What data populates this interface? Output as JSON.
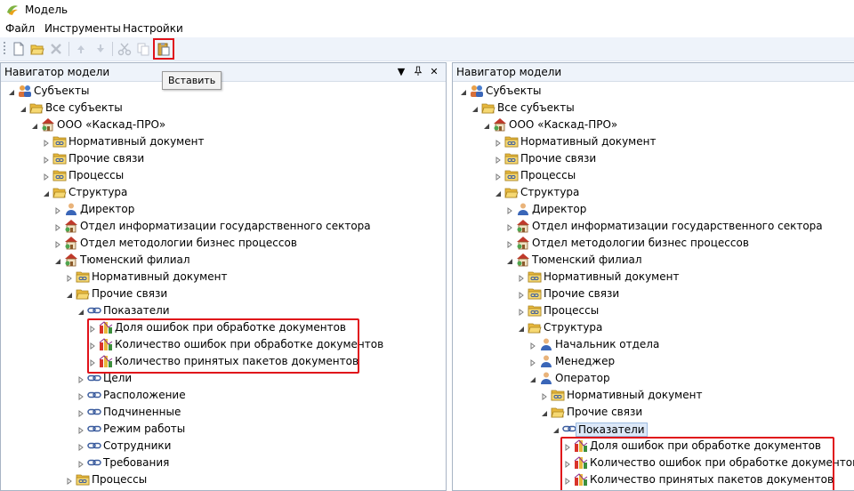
{
  "window": {
    "title": "Модель"
  },
  "menu": [
    "Файл",
    "Инструменты",
    "Настройки"
  ],
  "toolbar": {
    "tooltip": "Вставить"
  },
  "panels": [
    {
      "title": "Навигатор модели",
      "has_controls": true,
      "nodes": [
        {
          "d": 0,
          "exp": "open",
          "icon": "subjects-icon",
          "label": "Субъекты"
        },
        {
          "d": 1,
          "exp": "open",
          "icon": "folder-open-icon",
          "label": "Все субъекты"
        },
        {
          "d": 2,
          "exp": "open",
          "icon": "organization-icon",
          "label": "ООО «Каскад-ПРО»"
        },
        {
          "d": 3,
          "exp": "closed",
          "icon": "folder-link-icon",
          "label": "Нормативный документ"
        },
        {
          "d": 3,
          "exp": "closed",
          "icon": "folder-link-icon",
          "label": "Прочие связи"
        },
        {
          "d": 3,
          "exp": "closed",
          "icon": "folder-link-icon",
          "label": "Процессы"
        },
        {
          "d": 3,
          "exp": "open",
          "icon": "folder-open-icon",
          "label": "Структура"
        },
        {
          "d": 4,
          "exp": "closed",
          "icon": "person-icon",
          "label": "Директор"
        },
        {
          "d": 4,
          "exp": "closed",
          "icon": "organization-icon",
          "label": "Отдел информатизации государственного сектора"
        },
        {
          "d": 4,
          "exp": "closed",
          "icon": "organization-icon",
          "label": "Отдел методологии бизнес процессов"
        },
        {
          "d": 4,
          "exp": "open",
          "icon": "organization-icon",
          "label": "Тюменский филиал"
        },
        {
          "d": 5,
          "exp": "closed",
          "icon": "folder-link-icon",
          "label": "Нормативный документ"
        },
        {
          "d": 5,
          "exp": "open",
          "icon": "folder-open-icon",
          "label": "Прочие связи"
        },
        {
          "d": 6,
          "exp": "open",
          "icon": "link-icon",
          "label": "Показатели"
        },
        {
          "d": 7,
          "exp": "closed",
          "icon": "indicator-icon",
          "label": "Доля ошибок при обработке документов"
        },
        {
          "d": 7,
          "exp": "closed",
          "icon": "indicator-icon",
          "label": "Количество ошибок при обработке документов"
        },
        {
          "d": 7,
          "exp": "closed",
          "icon": "indicator-icon",
          "label": "Количество принятых пакетов документов"
        },
        {
          "d": 6,
          "exp": "closed",
          "icon": "link-icon",
          "label": "Цели"
        },
        {
          "d": 6,
          "exp": "closed",
          "icon": "link-icon",
          "label": "Расположение"
        },
        {
          "d": 6,
          "exp": "closed",
          "icon": "link-icon",
          "label": "Подчиненные"
        },
        {
          "d": 6,
          "exp": "closed",
          "icon": "link-icon",
          "label": "Режим работы"
        },
        {
          "d": 6,
          "exp": "closed",
          "icon": "link-icon",
          "label": "Сотрудники"
        },
        {
          "d": 6,
          "exp": "closed",
          "icon": "link-icon",
          "label": "Требования"
        },
        {
          "d": 5,
          "exp": "closed",
          "icon": "folder-link-icon",
          "label": "Процессы"
        }
      ]
    },
    {
      "title": "Навигатор модели",
      "has_controls": false,
      "nodes": [
        {
          "d": 0,
          "exp": "open",
          "icon": "subjects-icon",
          "label": "Субъекты"
        },
        {
          "d": 1,
          "exp": "open",
          "icon": "folder-open-icon",
          "label": "Все субъекты"
        },
        {
          "d": 2,
          "exp": "open",
          "icon": "organization-icon",
          "label": "ООО «Каскад-ПРО»"
        },
        {
          "d": 3,
          "exp": "closed",
          "icon": "folder-link-icon",
          "label": "Нормативный документ"
        },
        {
          "d": 3,
          "exp": "closed",
          "icon": "folder-link-icon",
          "label": "Прочие связи"
        },
        {
          "d": 3,
          "exp": "closed",
          "icon": "folder-link-icon",
          "label": "Процессы"
        },
        {
          "d": 3,
          "exp": "open",
          "icon": "folder-open-icon",
          "label": "Структура"
        },
        {
          "d": 4,
          "exp": "closed",
          "icon": "person-icon",
          "label": "Директор"
        },
        {
          "d": 4,
          "exp": "closed",
          "icon": "organization-icon",
          "label": "Отдел информатизации государственного сектора"
        },
        {
          "d": 4,
          "exp": "closed",
          "icon": "organization-icon",
          "label": "Отдел методологии бизнес процессов"
        },
        {
          "d": 4,
          "exp": "open",
          "icon": "organization-icon",
          "label": "Тюменский филиал"
        },
        {
          "d": 5,
          "exp": "closed",
          "icon": "folder-link-icon",
          "label": "Нормативный документ"
        },
        {
          "d": 5,
          "exp": "closed",
          "icon": "folder-link-icon",
          "label": "Прочие связи"
        },
        {
          "d": 5,
          "exp": "closed",
          "icon": "folder-link-icon",
          "label": "Процессы"
        },
        {
          "d": 5,
          "exp": "open",
          "icon": "folder-open-icon",
          "label": "Структура"
        },
        {
          "d": 6,
          "exp": "closed",
          "icon": "person-icon",
          "label": "Начальник отдела"
        },
        {
          "d": 6,
          "exp": "closed",
          "icon": "person-icon",
          "label": "Менеджер"
        },
        {
          "d": 6,
          "exp": "open",
          "icon": "person-icon",
          "label": "Оператор"
        },
        {
          "d": 7,
          "exp": "closed",
          "icon": "folder-link-icon",
          "label": "Нормативный документ"
        },
        {
          "d": 7,
          "exp": "open",
          "icon": "folder-open-icon",
          "label": "Прочие связи"
        },
        {
          "d": 8,
          "exp": "open",
          "icon": "link-icon",
          "label": "Показатели",
          "selected": true
        },
        {
          "d": 9,
          "exp": "closed",
          "icon": "indicator-icon",
          "label": "Доля ошибок при обработке документов"
        },
        {
          "d": 9,
          "exp": "closed",
          "icon": "indicator-icon",
          "label": "Количество ошибок при обработке документов"
        },
        {
          "d": 9,
          "exp": "closed",
          "icon": "indicator-icon",
          "label": "Количество принятых пакетов документов"
        }
      ]
    }
  ]
}
